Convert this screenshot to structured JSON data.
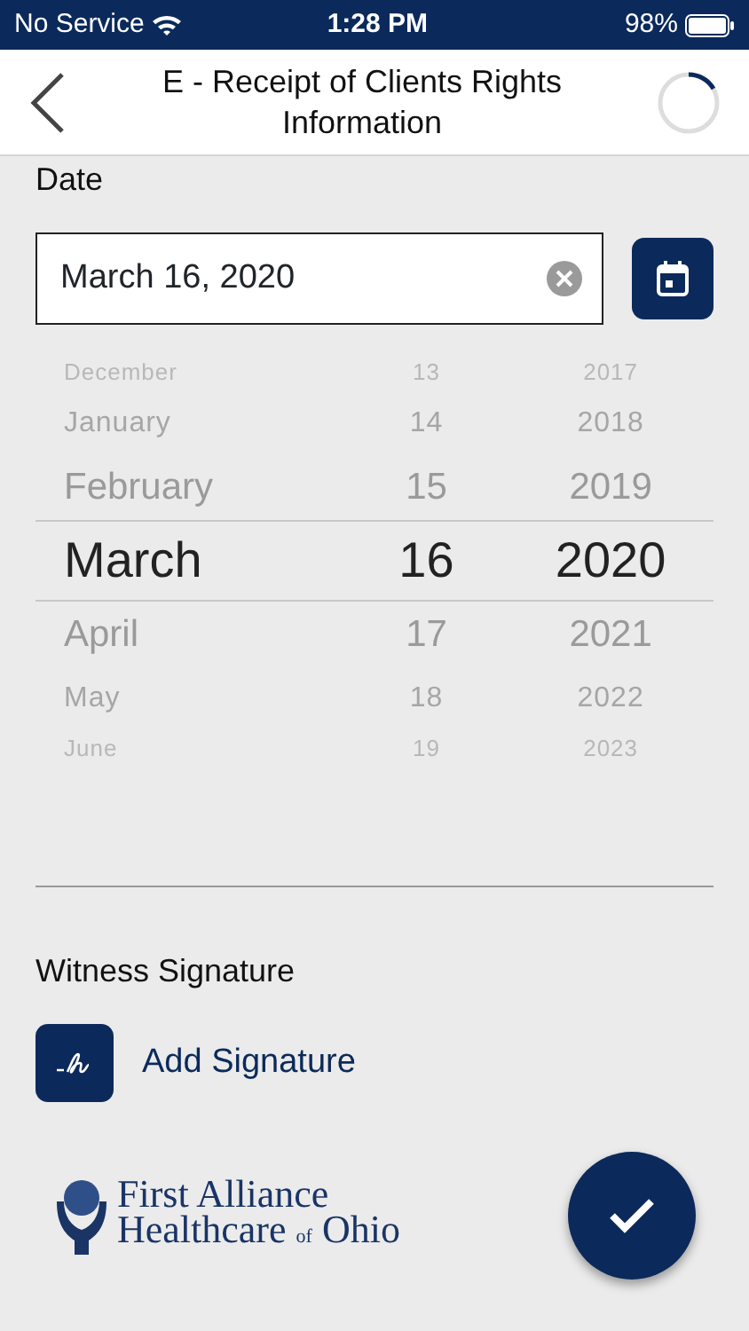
{
  "status_bar": {
    "carrier": "No Service",
    "time": "1:28 PM",
    "battery": "98%"
  },
  "header": {
    "title": "E - Receipt of Clients Rights Information"
  },
  "date_field": {
    "label": "Date",
    "value": "March 16, 2020"
  },
  "picker": {
    "rows": [
      {
        "month": "December",
        "day": "13",
        "year": "2017",
        "selected": false
      },
      {
        "month": "January",
        "day": "14",
        "year": "2018",
        "selected": false
      },
      {
        "month": "February",
        "day": "15",
        "year": "2019",
        "selected": false
      },
      {
        "month": "March",
        "day": "16",
        "year": "2020",
        "selected": true
      },
      {
        "month": "April",
        "day": "17",
        "year": "2021",
        "selected": false
      },
      {
        "month": "May",
        "day": "18",
        "year": "2022",
        "selected": false
      },
      {
        "month": "June",
        "day": "19",
        "year": "2023",
        "selected": false
      }
    ]
  },
  "witness": {
    "label": "Witness Signature",
    "button": "Add Signature"
  },
  "logo": {
    "line1": "First Alliance",
    "line2": "Healthcare",
    "small": "of",
    "line3": "Ohio"
  }
}
